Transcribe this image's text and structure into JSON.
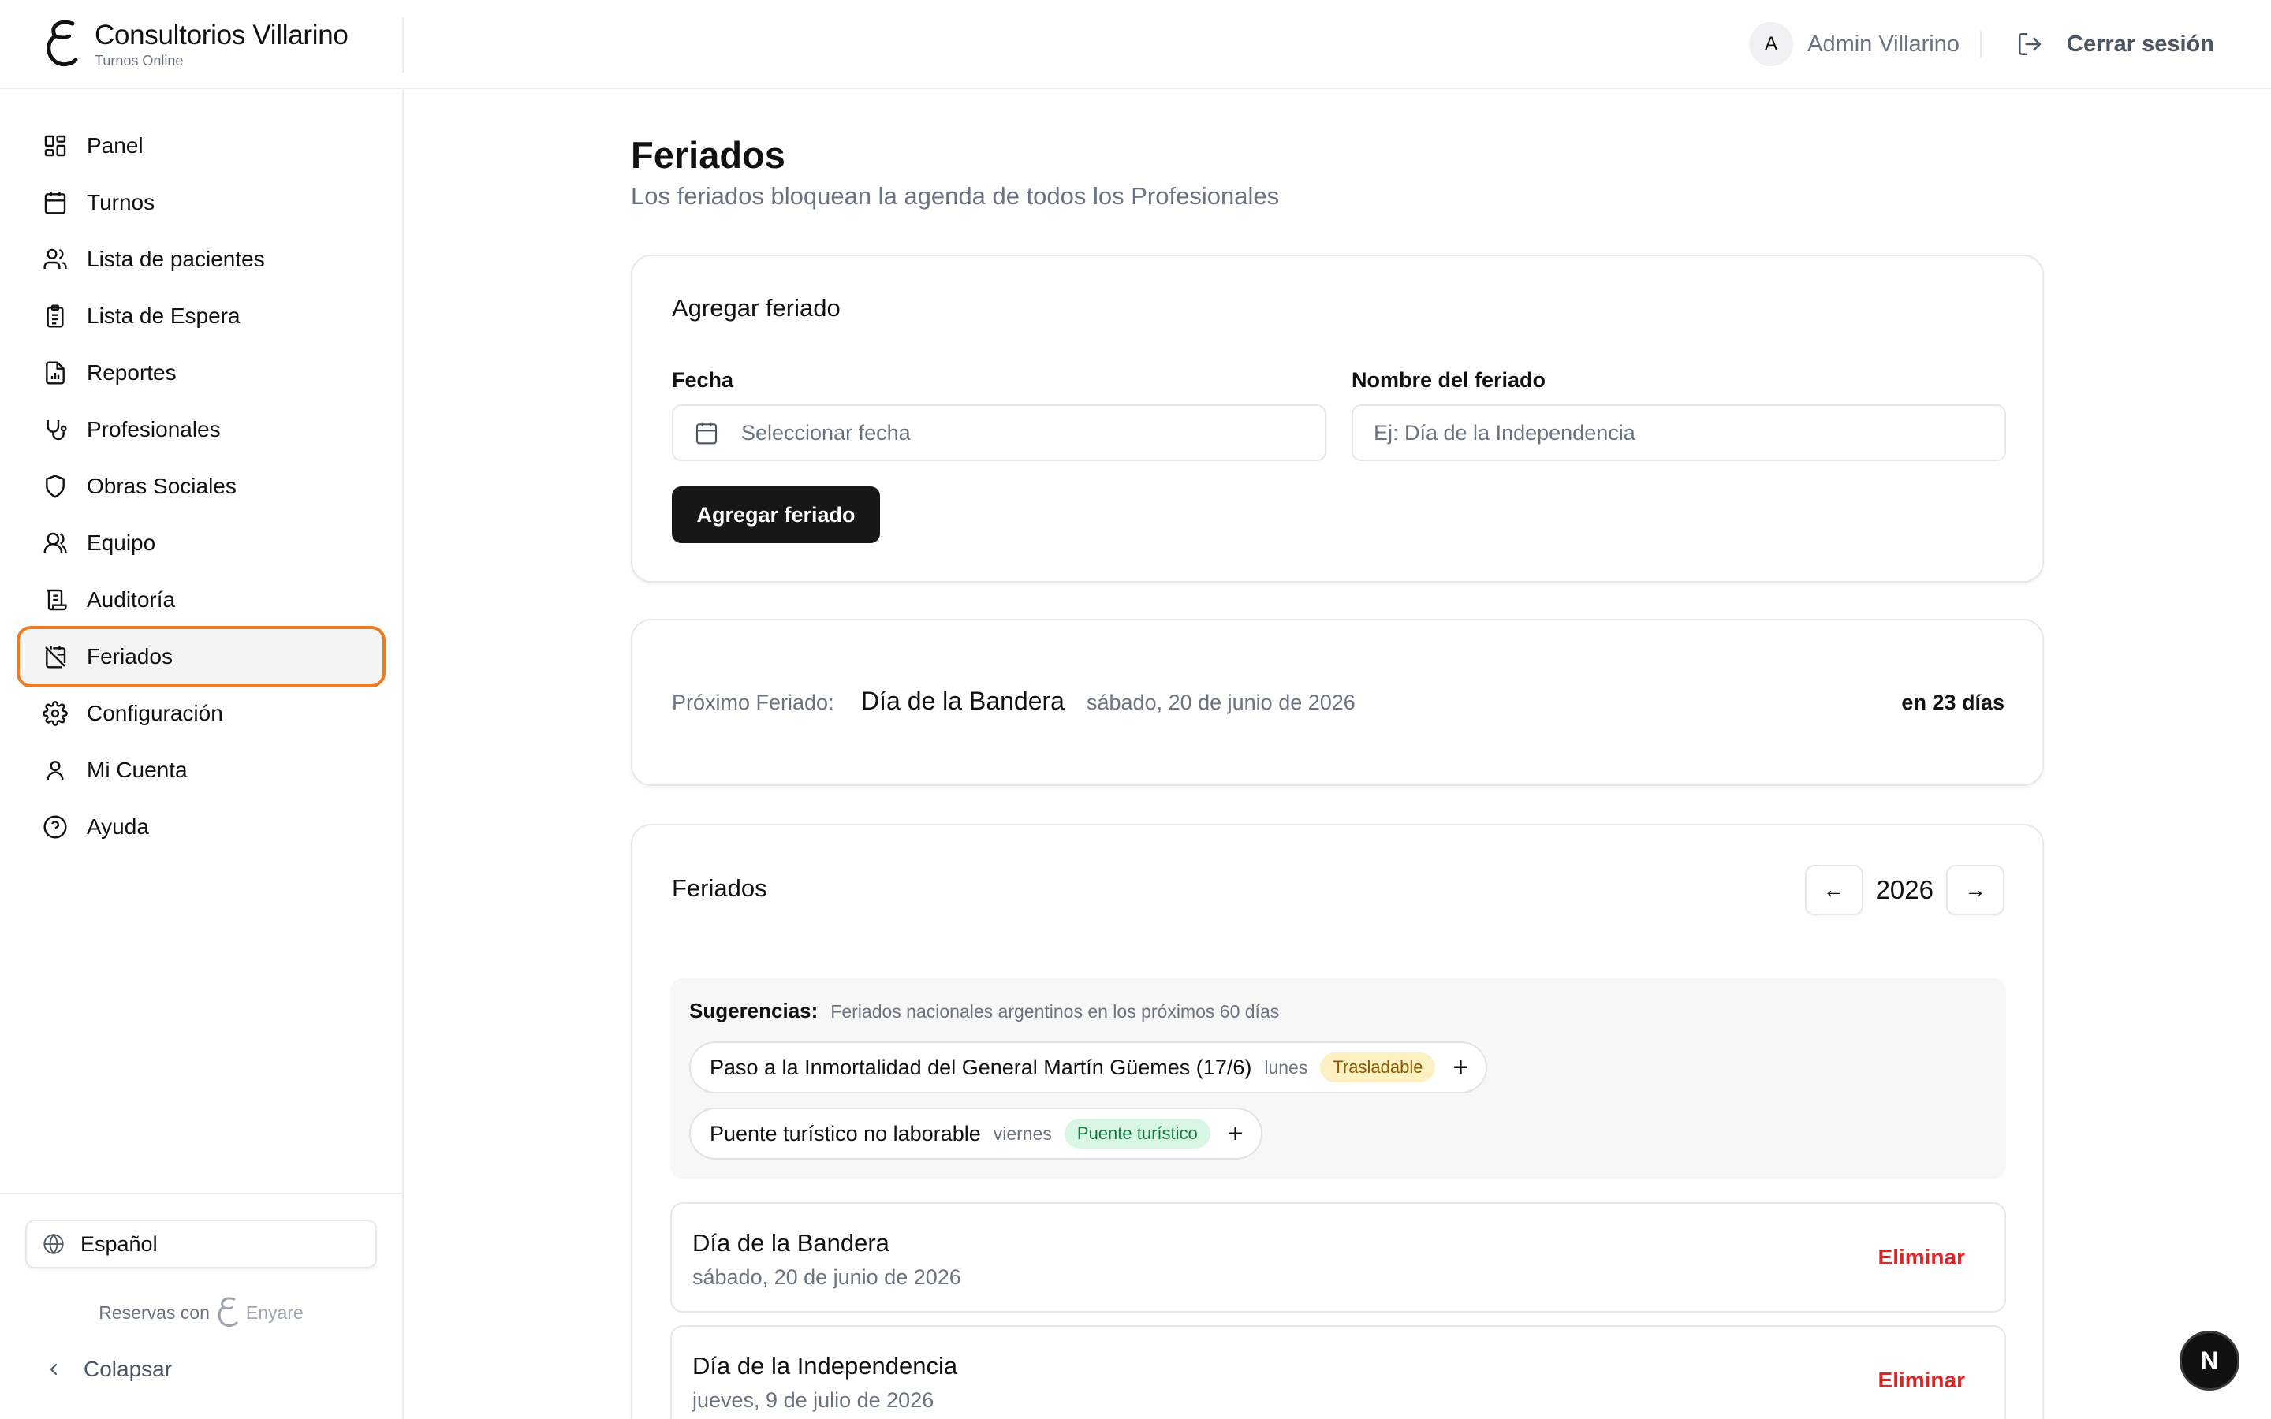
{
  "brand": {
    "name": "Consultorios Villarino",
    "subtitle": "Turnos Online"
  },
  "user": {
    "avatar_initial": "A",
    "name": "Admin Villarino",
    "logout_label": "Cerrar sesión"
  },
  "sidebar": {
    "items": [
      {
        "label": "Panel",
        "icon": "grid-icon"
      },
      {
        "label": "Turnos",
        "icon": "calendar-icon"
      },
      {
        "label": "Lista de pacientes",
        "icon": "users-icon"
      },
      {
        "label": "Lista de Espera",
        "icon": "clipboard-list-icon"
      },
      {
        "label": "Reportes",
        "icon": "report-icon"
      },
      {
        "label": "Profesionales",
        "icon": "stethoscope-icon"
      },
      {
        "label": "Obras Sociales",
        "icon": "shield-icon"
      },
      {
        "label": "Equipo",
        "icon": "team-icon"
      },
      {
        "label": "Auditoría",
        "icon": "scroll-icon"
      },
      {
        "label": "Feriados",
        "icon": "calendar-off-icon",
        "active": true
      },
      {
        "label": "Configuración",
        "icon": "gear-icon"
      },
      {
        "label": "Mi Cuenta",
        "icon": "user-icon"
      },
      {
        "label": "Ayuda",
        "icon": "help-circle-icon"
      }
    ],
    "language": "Español",
    "powered_by": "Reservas con",
    "powered_brand": "Enyare",
    "collapse_label": "Colapsar"
  },
  "page": {
    "title": "Feriados",
    "subtitle": "Los feriados bloquean la agenda de todos los Profesionales"
  },
  "add_form": {
    "title": "Agregar feriado",
    "date_label": "Fecha",
    "date_placeholder": "Seleccionar fecha",
    "name_label": "Nombre del feriado",
    "name_placeholder": "Ej: Día de la Independencia",
    "submit_label": "Agregar feriado"
  },
  "next_holiday": {
    "label": "Próximo Feriado:",
    "name": "Día de la Bandera",
    "date": "sábado, 20 de junio de 2026",
    "countdown": "en 23 días"
  },
  "holidays": {
    "title": "Feriados",
    "prev_label": "←",
    "year": "2026",
    "next_label": "→",
    "suggestions": {
      "title": "Sugerencias:",
      "description": "Feriados nacionales argentinos en los próximos 60 días",
      "items": [
        {
          "name": "Paso a la Inmortalidad del General Martín Güemes (17/6)",
          "day": "lunes",
          "badge": "Trasladable",
          "badge_color": "#fdf1c4"
        },
        {
          "name": "Puente turístico no laborable",
          "day": "viernes",
          "badge": "Puente turístico",
          "badge_color": "#d8f6e3"
        }
      ],
      "add_symbol": "+"
    },
    "list": [
      {
        "name": "Día de la Bandera",
        "date": "sábado, 20 de junio de 2026",
        "action": "Eliminar"
      },
      {
        "name": "Día de la Independencia",
        "date": "jueves, 9 de julio de 2026",
        "action": "Eliminar"
      }
    ]
  },
  "fab": {
    "label": "N"
  },
  "colors": {
    "accent_outline": "#f07b1e",
    "primary_button": "#171717",
    "danger": "#dc2626"
  }
}
